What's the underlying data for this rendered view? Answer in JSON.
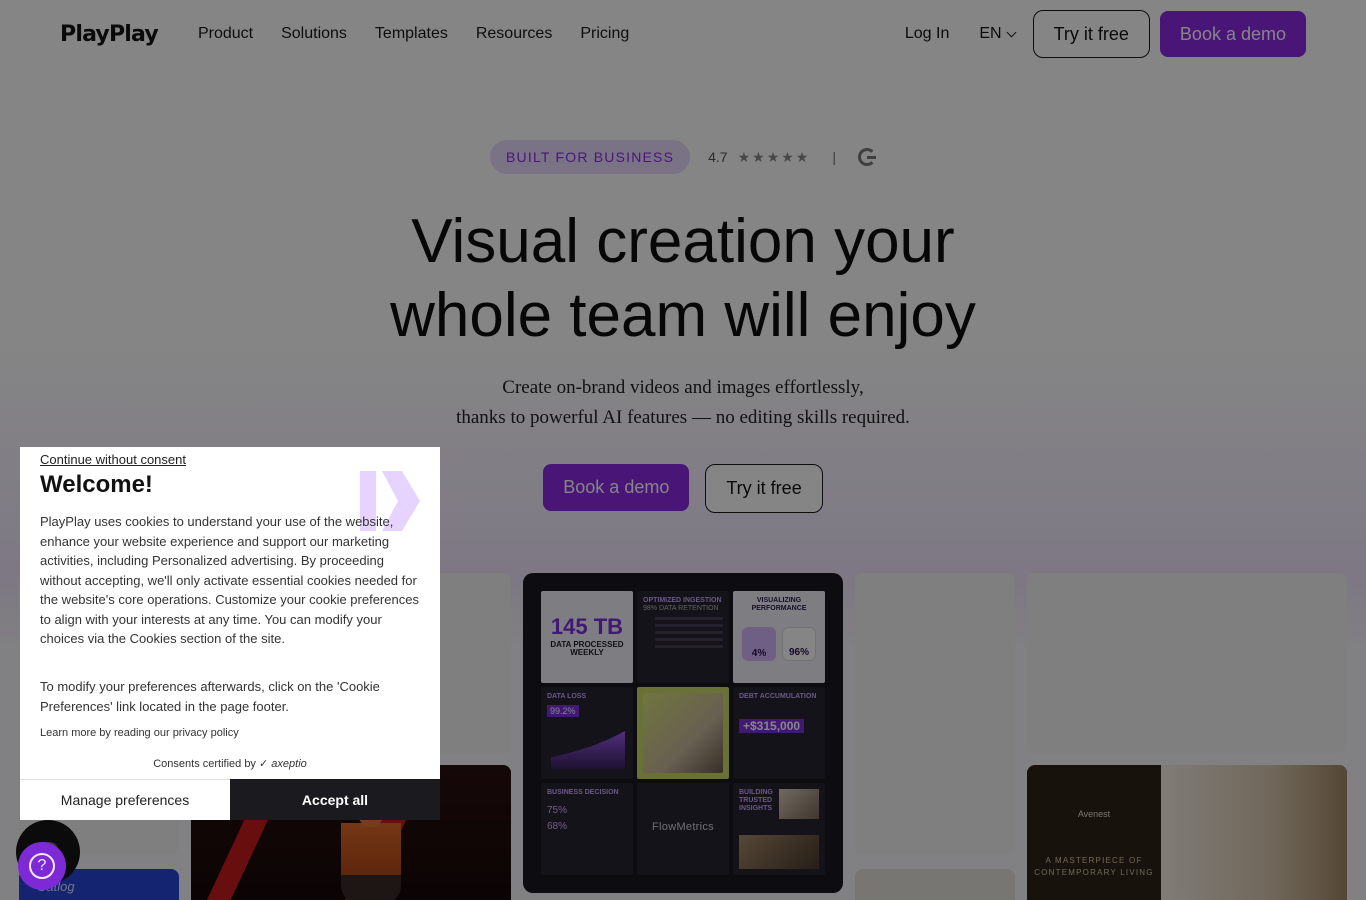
{
  "nav": {
    "logo": "PlayPlay",
    "links": [
      "Product",
      "Solutions",
      "Templates",
      "Resources",
      "Pricing"
    ],
    "login": "Log In",
    "lang": "EN",
    "try_free": "Try it free",
    "book_demo": "Book a demo"
  },
  "hero": {
    "badge": "BUILT FOR BUSINESS",
    "rating": "4.7",
    "stars": "★★★★★",
    "separator": "|",
    "headline_line1": "Visual creation your",
    "headline_line2": "whole team will enjoy",
    "sub_line1": "Create on-brand videos and images effortlessly,",
    "sub_line2": "thanks to powerful AI features — no editing skills required.",
    "cta_primary": "Book a demo",
    "cta_secondary": "Try it free"
  },
  "gallery": {
    "dashboard": {
      "big_number": "145 TB",
      "big_caption": "DATA PROCESSED WEEKLY",
      "ingestion_title": "OPTIMIZED INGESTION",
      "ingestion_sub": "98% DATA RETENTION",
      "perf_title": "VISUALIZING PERFORMANCE",
      "gauge1": "4%",
      "gauge2": "96%",
      "loss_title": "DATA LOSS",
      "loss_value": "99.2%",
      "debt_title": "DEBT ACCUMULATION",
      "debt_value": "+$315,000",
      "decision_title": "BUSINESS DECISION",
      "decision_value1": "75%",
      "decision_value2": "68%",
      "brand": "FlowMetrics",
      "insights_title": "BUILDING TRUSTED INSIGHTS"
    },
    "arch": {
      "brand": "Avenest",
      "tagline": "A MASTERPIECE OF CONTEMPORARY LIVING"
    },
    "blue": {
      "text": "Catlog"
    }
  },
  "cookie": {
    "skip": "Continue without consent",
    "title": "Welcome!",
    "body": "PlayPlay uses cookies to understand your use of the website, enhance your website experience and support our marketing activities, including Personalized advertising. By proceeding without accepting, we'll only activate essential cookies needed for the website's core operations. Customize your cookie preferences to align with your interests at any time. You can modify your choices via the Cookies section of the site.",
    "body2": "To modify your preferences afterwards, click on the 'Cookie Preferences' link located in the page footer.",
    "learn": "Learn more by reading our privacy policy",
    "certified": "Consents certified by",
    "certifier": "axeptio",
    "manage": "Manage preferences",
    "accept": "Accept all"
  },
  "help": {
    "icon": "?"
  },
  "colors": {
    "accent": "#8c2be6",
    "badge_bg": "#eadcff",
    "dark": "#1b1b1f"
  }
}
